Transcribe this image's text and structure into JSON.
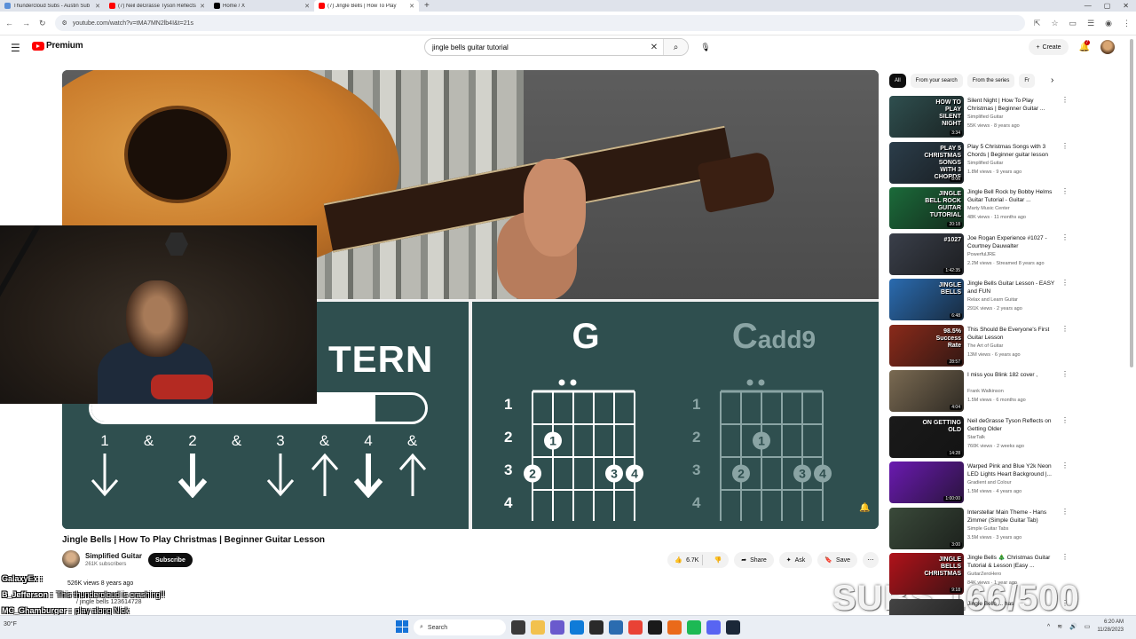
{
  "browser": {
    "tabs": [
      {
        "title": "Thundercloud Subs - Austin Sub",
        "color": "#5a8fd8"
      },
      {
        "title": "(7) Neil deGrasse Tyson Reflects",
        "color": "#ff0000"
      },
      {
        "title": "Home / X",
        "color": "#000000"
      },
      {
        "title": "(7) Jingle Bells | How To Play",
        "color": "#ff0000",
        "active": true
      }
    ],
    "new_tab": "+",
    "url": "youtube.com/watch?v=tMA7MN2lb4I&t=21s"
  },
  "header": {
    "logo_text": "Premium",
    "search_value": "jingle bells guitar tutorial",
    "search_placeholder": "Search",
    "create_label": "Create",
    "notification_count": "7"
  },
  "player": {
    "pattern_title": "TERN",
    "pattern_progress": 0.85,
    "beats": [
      "1",
      "&",
      "2",
      "&",
      "3",
      "&",
      "4",
      "&"
    ],
    "beat_arrows": [
      "down",
      "",
      "down-bold",
      "",
      "down",
      "up",
      "down-bold",
      "up"
    ],
    "fret_numbers": [
      "1",
      "2",
      "3",
      "4"
    ],
    "chord_1": {
      "name": "G",
      "dots": [
        {
          "string": 2,
          "fret": 2,
          "finger": "1"
        },
        {
          "string": 1,
          "fret": 3,
          "finger": "2"
        },
        {
          "string": 5,
          "fret": 3,
          "finger": "3"
        },
        {
          "string": 6,
          "fret": 3,
          "finger": "4"
        }
      ]
    },
    "chord_2": {
      "name": "Cadd9",
      "name_main": "C",
      "name_sub": "add9",
      "dots": [
        {
          "string": 3,
          "fret": 2,
          "finger": "1"
        },
        {
          "string": 2,
          "fret": 3,
          "finger": "2"
        },
        {
          "string": 5,
          "fret": 3,
          "finger": "3"
        },
        {
          "string": 6,
          "fret": 3,
          "finger": "4"
        }
      ]
    }
  },
  "video": {
    "title": "Jingle Bells | How To Play Christmas | Beginner Guitar Lesson",
    "channel": "Simplified Guitar",
    "subscribers": "261K subscribers",
    "subscribe_label": "Subscribe",
    "likes": "6.7K",
    "share_label": "Share",
    "ask_label": "Ask",
    "save_label": "Save",
    "views_line": "526K views  8 years ago",
    "desc_line": "/ jingle bells 123614728"
  },
  "chat": [
    {
      "user": "GalaxyEx :",
      "msg": ""
    },
    {
      "user": "B_Jefferson :",
      "msg": "This thundercloud is crashing!!"
    },
    {
      "user": "MC_Ghamburger :",
      "msg": "play along Nick"
    },
    {
      "user": "19979 :",
      "msg": ""
    }
  ],
  "subs_overlay": "SUBS 166/500",
  "sidebar": {
    "chips": [
      "All",
      "From your search",
      "From the series",
      "Fr"
    ],
    "items": [
      {
        "title": "Silent Night | How To Play Christmas | Beginner Guitar ...",
        "channel": "Simplified Guitar",
        "meta": "55K views · 8 years ago",
        "duration": "3:34",
        "thumb_text": "HOW TO PLAY SILENT NIGHT",
        "thumb_color": "#2f4f4f"
      },
      {
        "title": "Play 5 Christmas Songs with 3 Chords | Beginner guitar lesson",
        "channel": "Simplified Guitar",
        "meta": "1.8M views · 9 years ago",
        "duration": "8:06",
        "thumb_text": "PLAY 5 CHRISTMAS SONGS WITH 3 CHORDS",
        "thumb_color": "#2b3d4a"
      },
      {
        "title": "Jingle Bell Rock by Bobby Helms Guitar Tutorial - Guitar ...",
        "channel": "Marty Music Center",
        "meta": "48K views · 11 months ago",
        "duration": "20:18",
        "thumb_text": "JINGLE BELL ROCK GUITAR TUTORIAL",
        "thumb_color": "#1b6b3a"
      },
      {
        "title": "Joe Rogan Experience #1027 - Courtney Dauwalter",
        "channel": "PowerfulJRE",
        "meta": "2.2M views · Streamed 8 years ago",
        "duration": "1:42:35",
        "thumb_text": "#1027",
        "thumb_color": "#3a3f4a"
      },
      {
        "title": "Jingle Bells Guitar Lesson - EASY and FUN",
        "channel": "Relax and Learn Guitar",
        "meta": "291K views · 2 years ago",
        "duration": "6:48",
        "thumb_text": "JINGLE BELLS",
        "thumb_color": "#2a6bb0"
      },
      {
        "title": "This Should Be Everyone's First Guitar Lesson",
        "channel": "The Art of Guitar",
        "meta": "13M views · 6 years ago",
        "duration": "28:57",
        "thumb_text": "98.5% Success Rate",
        "thumb_color": "#8a2a1a"
      },
      {
        "title": "I miss you Blink 182 cover ,",
        "channel": "Frank Walkinson",
        "meta": "1.5M views · 6 months ago",
        "duration": "4:04",
        "thumb_text": "",
        "thumb_color": "#7a6a52"
      },
      {
        "title": "Neil deGrasse Tyson Reflects on Getting Older",
        "channel": "StarTalk",
        "meta": "760K views · 2 weeks ago",
        "duration": "14:28",
        "thumb_text": "ON GETTING OLD",
        "thumb_color": "#1a1a1a"
      },
      {
        "title": "Warped Pink and Blue Y2k Neon LED Lights Heart Background |...",
        "channel": "Gradient and Colour",
        "meta": "1.5M views · 4 years ago",
        "duration": "1:00:00",
        "thumb_text": "",
        "thumb_color": "#6a1ab0"
      },
      {
        "title": "Interstellar Main Theme - Hans Zimmer (Simple Guitar Tab)",
        "channel": "Simple Guitar Tabs",
        "meta": "3.5M views · 3 years ago",
        "duration": "3:00",
        "thumb_text": "",
        "thumb_color": "#3a4a3a"
      },
      {
        "title": "Jingle Bells 🎄 Christmas Guitar Tutorial & Lesson |Easy ...",
        "channel": "GuitarZeroHero",
        "meta": "84K views · 1 year ago",
        "duration": "9:18",
        "thumb_text": "JINGLE BELLS CHRISTMAS",
        "thumb_color": "#b0121a"
      },
      {
        "title": "Jingle Bells ... has",
        "channel": "",
        "meta": "",
        "duration": "",
        "thumb_text": "",
        "thumb_color": "#444444"
      }
    ]
  },
  "taskbar": {
    "search_label": "Search",
    "weather": "30°F",
    "time": "6:20 AM",
    "date": "11/28/2023"
  }
}
